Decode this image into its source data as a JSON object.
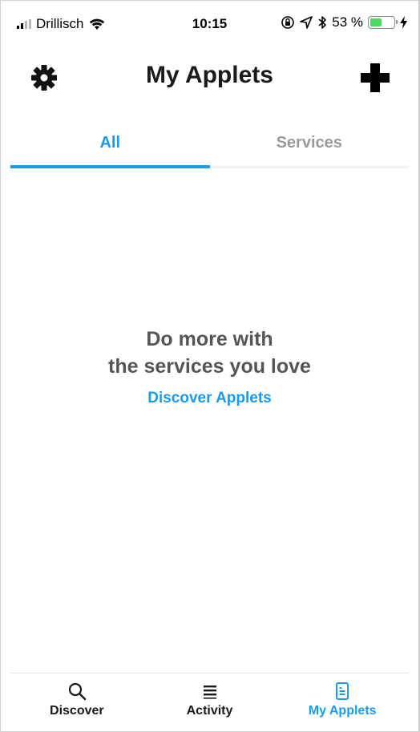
{
  "status_bar": {
    "carrier": "Drillisch",
    "time": "10:15",
    "battery_text": "53 %",
    "battery_level": 0.53
  },
  "header": {
    "title": "My Applets"
  },
  "tabs": [
    {
      "label": "All",
      "active": true
    },
    {
      "label": "Services",
      "active": false
    }
  ],
  "empty_state": {
    "line1": "Do more with",
    "line2": "the services you love",
    "link": "Discover Applets"
  },
  "bottom_nav": [
    {
      "label": "Discover",
      "icon": "search-icon"
    },
    {
      "label": "Activity",
      "icon": "list-icon"
    },
    {
      "label": "My Applets",
      "icon": "applets-icon",
      "active": true
    }
  ],
  "colors": {
    "accent": "#1a9bf0",
    "battery": "#4cd964",
    "title_text": "#1a1a1a",
    "muted_text": "#9a9a9a"
  }
}
